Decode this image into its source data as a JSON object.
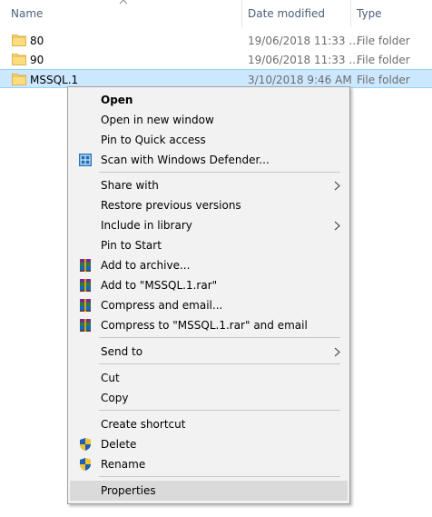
{
  "columns": {
    "name": "Name",
    "date": "Date modified",
    "type": "Type"
  },
  "files": [
    {
      "name": "80",
      "date": "19/06/2018 11:33 ...",
      "type": "File folder"
    },
    {
      "name": "90",
      "date": "19/06/2018 11:33 ...",
      "type": "File folder"
    },
    {
      "name": "MSSQL.1",
      "date": "3/10/2018 9:46 AM",
      "type": "File folder"
    }
  ],
  "menu": {
    "open": "Open",
    "open_new_window": "Open in new window",
    "pin_quick_access": "Pin to Quick access",
    "scan_defender": "Scan with Windows Defender...",
    "share_with": "Share with",
    "restore_versions": "Restore previous versions",
    "include_library": "Include in library",
    "pin_start": "Pin to Start",
    "add_archive": "Add to archive...",
    "add_rar": "Add to \"MSSQL.1.rar\"",
    "compress_email": "Compress and email...",
    "compress_rar_email": "Compress to \"MSSQL.1.rar\" and email",
    "send_to": "Send to",
    "cut": "Cut",
    "copy": "Copy",
    "create_shortcut": "Create shortcut",
    "delete": "Delete",
    "rename": "Rename",
    "properties": "Properties"
  },
  "icons": {
    "folder": "folder-icon",
    "defender": "windows-defender-icon",
    "winrar": "winrar-icon",
    "uac_shield": "uac-shield-icon",
    "submenu": "chevron-right-icon",
    "sort": "sort-ascending-icon"
  },
  "colors": {
    "selection": "#cce8ff",
    "selection_border": "#99d1ff",
    "menu_bg": "#f2f2f2",
    "menu_hover": "#dadada",
    "header_text": "#4c607a",
    "folder": "#f8d775"
  }
}
